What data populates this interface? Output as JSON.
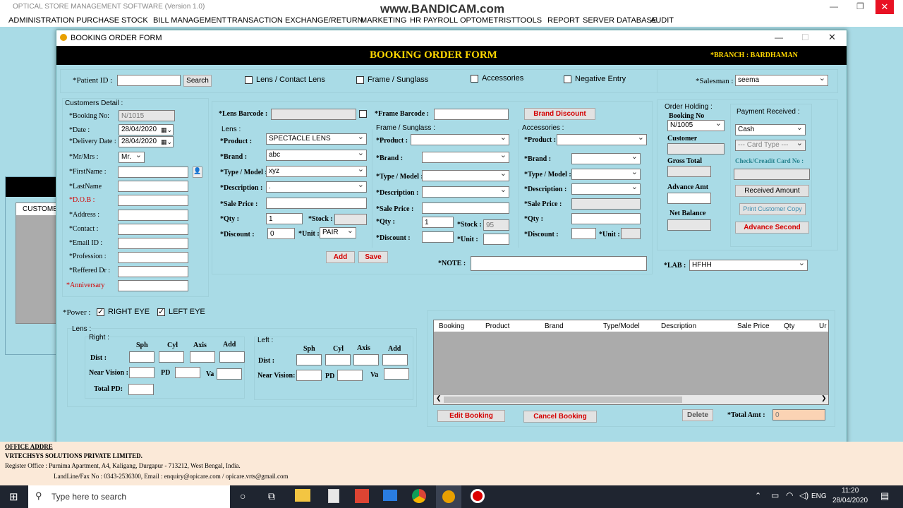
{
  "app": {
    "title": "OPTICAL STORE MANAGEMENT SOFTWARE (Version 1.0)",
    "watermark": "www.BANDICAM.com"
  },
  "menu": [
    "ADMINISTRATION",
    "PURCHASE",
    "STOCK",
    "BILL MANAGEMENT",
    "TRANSACTION",
    "EXCHANGE/RETURN",
    "MARKETING",
    "HR PAYROLL",
    "OPTOMETRIST",
    "TOOLS",
    "REPORT",
    "SERVER DATABASE",
    "AUDIT"
  ],
  "window": {
    "title": "BOOKING ORDER FORM",
    "heading": "BOOKING ORDER FORM",
    "branch": "*BRANCH :  BARDHAMAN"
  },
  "topbar": {
    "patient_label": "*Patient ID :",
    "search_label": "Search",
    "lens_contact": "Lens / Contact Lens",
    "frame_sunglass": "Frame / Sunglass",
    "accessories": "Accessories",
    "negative_entry": "Negative Entry",
    "salesman_label": "*Salesman :",
    "salesman_value": "seema"
  },
  "customer": {
    "group": "Customers Detail :",
    "booking_no_label": "*Booking No:",
    "booking_no": "N/1015",
    "date_label": "*Date :",
    "date": "28/04/2020",
    "delivery_label": "*Delivery Date :",
    "delivery": "28/04/2020",
    "title_label": "*Mr/Mrs :",
    "title_value": "Mr.",
    "first_name": "*FirstName :",
    "last_name": "*LastName",
    "dob": "*D.O.B :",
    "address": "*Address :",
    "contact": "*Contact :",
    "email": "*Email ID :",
    "profession": "*Profession :",
    "referred": "*Reffered Dr :",
    "anniversary": "*Anniversary"
  },
  "lens": {
    "barcode_label": "*Lens Barcode :",
    "group": "Lens :",
    "product_label": "*Product :",
    "product": "SPECTACLE LENS",
    "brand_label": "*Brand :",
    "brand": "abc",
    "model_label": "*Type / Model :",
    "model": "xyz",
    "desc_label": "*Description :",
    "desc": ".",
    "price_label": "*Sale Price :",
    "qty_label": "*Qty :",
    "qty": "1",
    "stock_label": "*Stock :",
    "discount_label": "*Discount :",
    "discount": "0",
    "unit_label": "*Unit :",
    "unit": "PAIR"
  },
  "frame": {
    "barcode_label": "*Frame Barcode :",
    "group": "Frame / Sunglass :",
    "product_label": "*Product :",
    "brand_label": "*Brand :",
    "model_label": "*Type / Model :",
    "desc_label": "*Description :",
    "price_label": "*Sale Price :",
    "qty_label": "*Qty :",
    "qty": "1",
    "stock_label": "*Stock :",
    "stock": "95",
    "discount_label": "*Discount :",
    "unit_label": "*Unit :"
  },
  "acc": {
    "brand_discount": "Brand Discount",
    "group": "Accessories :",
    "product_label": "*Product :",
    "brand_label": "*Brand :",
    "model_label": "*Type / Model :",
    "desc_label": "*Description :",
    "price_label": "*Sale Price :",
    "qty_label": "*Qty :",
    "discount_label": "*Discount :",
    "unit_label": "*Unit :"
  },
  "actions": {
    "add": "Add",
    "save": "Save",
    "note_label": "*NOTE :",
    "lab_label": "*LAB :",
    "lab_value": "HFHH"
  },
  "order": {
    "group": "Order Holding :",
    "booking_no_label": "Booking No",
    "booking_no": "N/1005",
    "customer_label": "Customer",
    "gross_label": "Gross Total",
    "advance_label": "Advance Amt",
    "net_label": "Net Balance"
  },
  "payment": {
    "group": "Payment Received :",
    "mode": "Cash",
    "card_type": "--- Card Type ---",
    "card_no_label": "Check/Creadit Card No :",
    "received": "Received Amount",
    "print": "Print Customer Copy",
    "advance_second": "Advance Second"
  },
  "power": {
    "label": "*Power :",
    "right_eye": "RIGHT EYE",
    "left_eye": "LEFT EYE",
    "lens_group": "Lens :",
    "right": "Right :",
    "left": "Left :",
    "sph": "Sph",
    "cyl": "Cyl",
    "axis": "Axis",
    "add": "Add",
    "dist": "Dist :",
    "near": "Near Vision :",
    "near_left": "Near Vision:",
    "pd": "PD",
    "va": "Va",
    "total_pd": "Total PD:"
  },
  "grid": {
    "columns": [
      "Booking",
      "Product",
      "Brand",
      "Type/Model",
      "Description",
      "Sale Price",
      "Qty",
      "Ur"
    ],
    "edit": "Edit Booking",
    "cancel": "Cancel Booking",
    "delete": "Delete",
    "total_label": "*Total Amt :",
    "total": "0"
  },
  "bg": {
    "customer_tab": "CUSTOMER",
    "office": "OFFICE ADDRE"
  },
  "footer": {
    "company": "VRTECHSYS SOLUTIONS PRIVATE LIMITED.",
    "address": "Register Office : Purnima Apartment, A4, Kaligang, Durgapur - 713212, West Bengal, India.",
    "contact": "LandLine/Fax No : 0343-2536300, Email : enquiry@opicare.com / opicare.vrts@gmail.com"
  },
  "taskbar": {
    "search": "Type here to search",
    "lang": "ENG",
    "time": "11:20",
    "date": "28/04/2020"
  },
  "colors": {
    "accent_yellow": "#ffd700",
    "form_bg": "#a9dbe6",
    "total_bg": "#fbd3b4"
  }
}
